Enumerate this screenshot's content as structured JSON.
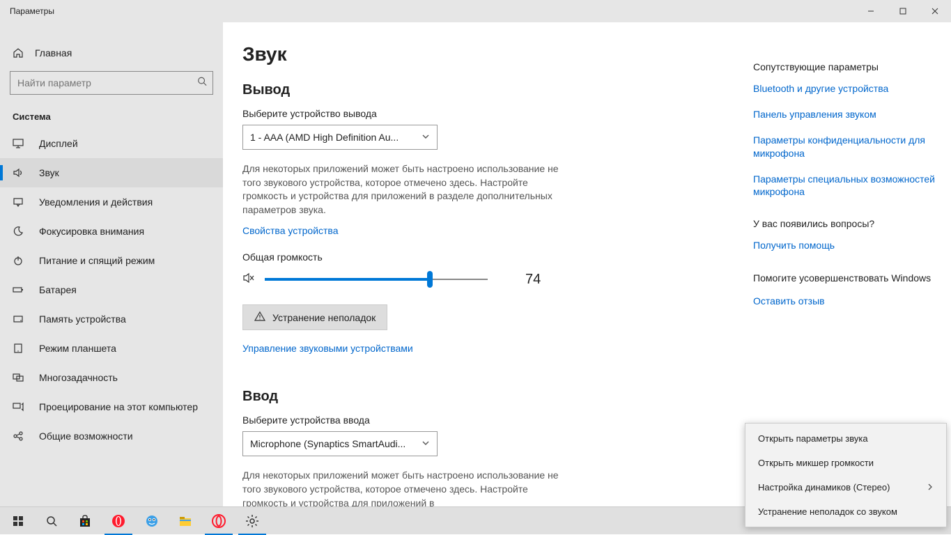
{
  "titlebar": {
    "title": "Параметры"
  },
  "sidebar": {
    "home": "Главная",
    "search_placeholder": "Найти параметр",
    "group": "Система",
    "items": [
      {
        "icon": "display",
        "label": "Дисплей"
      },
      {
        "icon": "sound",
        "label": "Звук"
      },
      {
        "icon": "notify",
        "label": "Уведомления и действия"
      },
      {
        "icon": "focus",
        "label": "Фокусировка внимания"
      },
      {
        "icon": "power",
        "label": "Питание и спящий режим"
      },
      {
        "icon": "battery",
        "label": "Батарея"
      },
      {
        "icon": "storage",
        "label": "Память устройства"
      },
      {
        "icon": "tablet",
        "label": "Режим планшета"
      },
      {
        "icon": "multitask",
        "label": "Многозадачность"
      },
      {
        "icon": "project",
        "label": "Проецирование на этот компьютер"
      },
      {
        "icon": "shared",
        "label": "Общие возможности"
      }
    ],
    "active_index": 1
  },
  "content": {
    "page_title": "Звук",
    "output": {
      "heading": "Вывод",
      "device_label": "Выберите устройство вывода",
      "device_value": "1 - AAA (AMD High Definition Au...",
      "desc": "Для некоторых приложений может быть настроено использование не того звукового устройства, которое отмечено здесь. Настройте громкость и устройства для приложений в разделе дополнительных параметров звука.",
      "props_link": "Свойства устройства",
      "volume_label": "Общая громкость",
      "volume_value": 74,
      "troubleshoot": "Устранение неполадок",
      "manage_link": "Управление звуковыми устройствами"
    },
    "input": {
      "heading": "Ввод",
      "device_label": "Выберите устройства ввода",
      "device_value": "Microphone (Synaptics SmartAudi...",
      "desc": "Для некоторых приложений может быть настроено использование не того звукового устройства, которое отмечено здесь. Настройте громкость и устройства для приложений в"
    }
  },
  "right": {
    "related_heading": "Сопутствующие параметры",
    "related_links": [
      "Bluetooth и другие устройства",
      "Панель управления звуком",
      "Параметры конфиденциальности для микрофона",
      "Параметры специальных возможностей микрофона"
    ],
    "questions_heading": "У вас появились вопросы?",
    "help_link": "Получить помощь",
    "improve_heading": "Помогите усовершенствовать Windows",
    "feedback_link": "Оставить отзыв"
  },
  "context_menu": {
    "items": [
      {
        "label": "Открыть параметры звука",
        "sub": false
      },
      {
        "label": "Открыть микшер громкости",
        "sub": false
      },
      {
        "label": "Настройка динамиков (Стерео)",
        "sub": true
      },
      {
        "label": "Устранение неполадок со звуком",
        "sub": false
      }
    ]
  }
}
